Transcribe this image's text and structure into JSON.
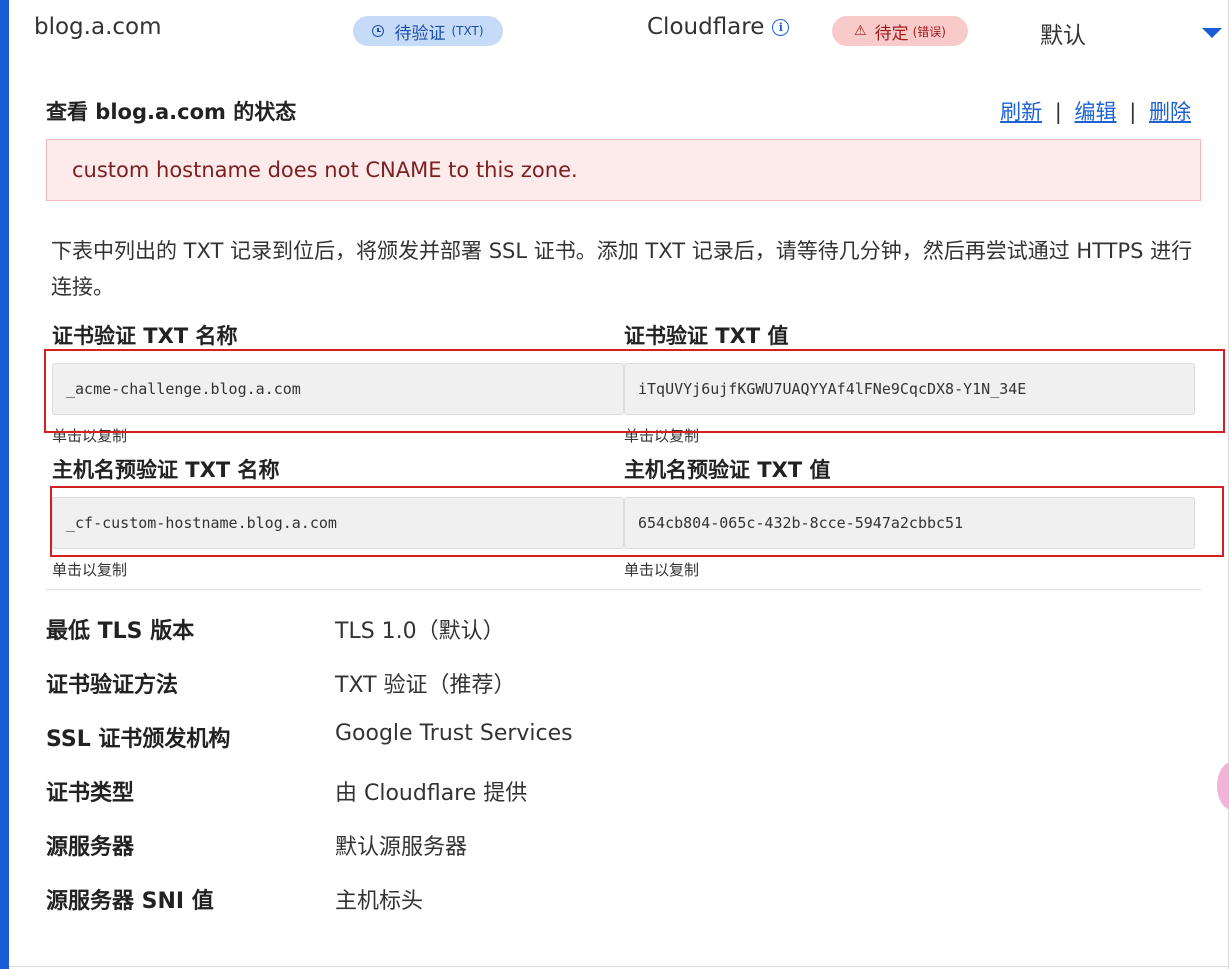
{
  "header": {
    "hostname": "blog.a.com",
    "verify_badge": "待验证",
    "verify_badge_sub": "(TXT)",
    "provider": "Cloudflare",
    "pending_badge": "待定",
    "pending_badge_sub": "(错误)",
    "default_label": "默认"
  },
  "section": {
    "title": "查看 blog.a.com 的状态",
    "refresh": "刷新",
    "edit": "编辑",
    "delete": "删除",
    "separator": "|",
    "error_message": "custom hostname does not CNAME to this zone.",
    "description": "下表中列出的 TXT 记录到位后，将颁发并部署 SSL 证书。添加 TXT 记录后，请等待几分钟，然后再尝试通过 HTTPS 进行连接。"
  },
  "records": {
    "cert_name_label": "证书验证 TXT 名称",
    "cert_name_value": "_acme-challenge.blog.a.com",
    "cert_value_label": "证书验证 TXT 值",
    "cert_value_value": "iTqUVYj6ujfKGWU7UAQYYAf4lFNe9CqcDX8-Y1N_34E",
    "host_name_label": "主机名预验证 TXT 名称",
    "host_name_value": "_cf-custom-hostname.blog.a.com",
    "host_value_label": "主机名预验证 TXT 值",
    "host_value_value": "654cb804-065c-432b-8cce-5947a2cbbc51",
    "copy_hint": "单击以复制"
  },
  "properties": [
    {
      "key": "最低 TLS 版本",
      "value": "TLS 1.0（默认）"
    },
    {
      "key": "证书验证方法",
      "value": "TXT 验证（推荐）"
    },
    {
      "key": "SSL 证书颁发机构",
      "value": "Google Trust Services"
    },
    {
      "key": "证书类型",
      "value": "由 Cloudflare 提供"
    },
    {
      "key": "源服务器",
      "value": "默认源服务器"
    },
    {
      "key": "源服务器 SNI 值",
      "value": "主机标头"
    }
  ],
  "colors": {
    "accent": "#1a5bd6",
    "verify_badge_bg": "#c6dbf7",
    "pending_badge_bg": "#f8caca",
    "error_bg": "#fdeaea",
    "highlight_outline": "#d32020"
  },
  "icons": {
    "verify": "clock-icon",
    "provider_info": "info-icon",
    "pending": "warning-icon",
    "expand": "chevron-down-icon"
  }
}
